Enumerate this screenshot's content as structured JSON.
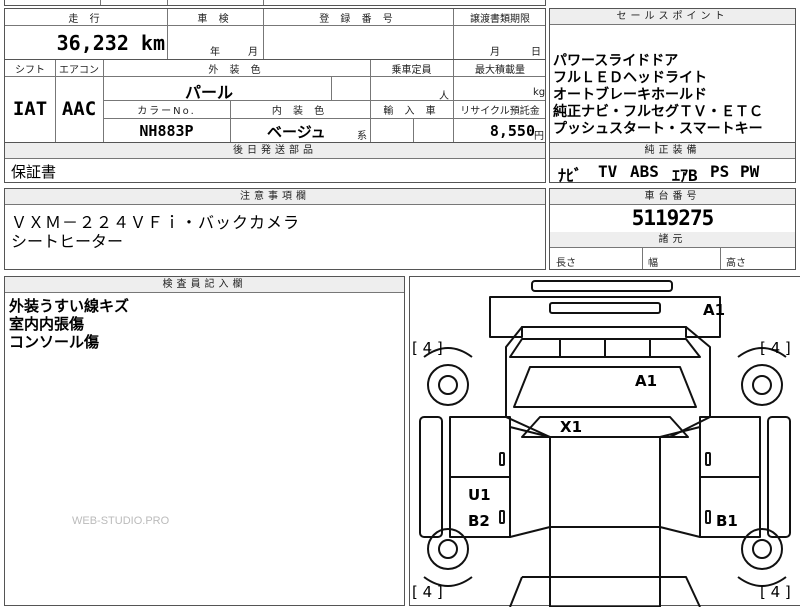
{
  "header": {
    "mileage_label": "走 行",
    "mileage_value": "36,232 km",
    "shaken_label": "車 検",
    "shaken_year": "年",
    "shaken_month": "月",
    "reg_label": "登 録 番 号",
    "transfer_label": "譲渡書類期限",
    "transfer_month": "月",
    "transfer_day": "日",
    "sales_label": "セールスポイント"
  },
  "spec": {
    "shift_label": "シフト",
    "shift_value": "IAT",
    "ac_label": "エアコン",
    "ac_value": "AAC",
    "exterior_label": "外 装 色",
    "exterior_value": "パール",
    "capacity_label": "乗車定員",
    "capacity_unit": "人",
    "load_label": "最大積載量",
    "load_unit": "kg",
    "colorno_label": "カラーNo.",
    "colorno_value": "NH883P",
    "interior_label": "内 装 色",
    "interior_value": "ベージュ",
    "interior_suffix": "系",
    "import_label": "輸 入 車",
    "recycle_label": "リサイクル預託金",
    "recycle_value": "8,550",
    "recycle_unit": "円"
  },
  "sales_points": [
    "パワースライドドア",
    "フルＬＥＤヘッドライト",
    "オートブレーキホールド",
    "純正ナビ・フルセグＴＶ・ＥＴＣ",
    "プッシュスタート・スマートキー"
  ],
  "parts": {
    "label": "後日発送部品",
    "value": "保証書"
  },
  "equipment": {
    "label": "純正装備",
    "items": [
      "ﾅﾋﾞ",
      "TV",
      "ABS",
      "ｴｱB",
      "PS",
      "PW"
    ]
  },
  "notes": {
    "label": "注意事項欄",
    "lines": [
      "ＶＸＭ－２２４ＶＦｉ・バックカメラ",
      "シートヒーター"
    ]
  },
  "chassis": {
    "label": "車台番号",
    "value": "5119275"
  },
  "dimensions": {
    "label": "諸元",
    "length": "長さ",
    "width": "幅",
    "height": "高さ"
  },
  "inspector": {
    "label": "検査員記入欄",
    "lines": [
      "外装うすい線キズ",
      "室内内張傷",
      "コンソール傷"
    ]
  },
  "diagram": {
    "marks": {
      "a1_top": "A1",
      "a1_hood": "A1",
      "x1": "X1",
      "u1": "U1",
      "b2": "B2",
      "b1": "B1"
    },
    "tires": [
      "[ 4 ]",
      "[ 4 ]",
      "[ 4 ]",
      "[ 4 ]"
    ]
  },
  "watermark": "WEB-STUDIO.PRO"
}
